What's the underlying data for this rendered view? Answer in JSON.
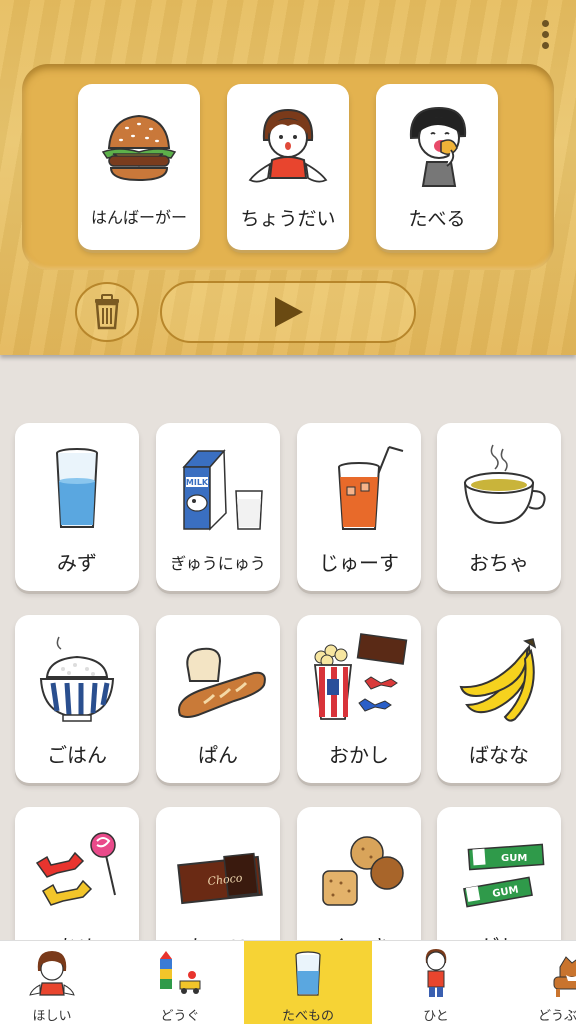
{
  "sentence_cards": [
    {
      "label": "はんばーがー",
      "icon": "hamburger-icon"
    },
    {
      "label": "ちょうだい",
      "icon": "give-me-person-icon"
    },
    {
      "label": "たべる",
      "icon": "eating-person-icon"
    }
  ],
  "controls": {
    "trash_icon": "trash-icon",
    "play_icon": "play-icon",
    "menu_icon": "more-vertical-icon"
  },
  "word_cards": [
    {
      "label": "みず",
      "icon": "water-glass-icon"
    },
    {
      "label": "ぎゅうにゅう",
      "icon": "milk-carton-icon"
    },
    {
      "label": "じゅーす",
      "icon": "juice-glass-icon"
    },
    {
      "label": "おちゃ",
      "icon": "tea-cup-icon"
    },
    {
      "label": "ごはん",
      "icon": "rice-bowl-icon"
    },
    {
      "label": "ぱん",
      "icon": "bread-icon"
    },
    {
      "label": "おかし",
      "icon": "snacks-icon"
    },
    {
      "label": "ばなな",
      "icon": "banana-icon"
    },
    {
      "label": "あめ",
      "icon": "candy-icon"
    },
    {
      "label": "ちょこ",
      "icon": "chocolate-icon"
    },
    {
      "label": "くっき",
      "icon": "cookie-icon"
    },
    {
      "label": "がむ",
      "icon": "gum-icon"
    }
  ],
  "tabs": [
    {
      "label": "ほしい",
      "icon": "want-person-icon",
      "active": false
    },
    {
      "label": "どうぐ",
      "icon": "tools-toys-icon",
      "active": false
    },
    {
      "label": "たべもの",
      "icon": "food-glass-icon",
      "active": true
    },
    {
      "label": "ひと",
      "icon": "people-icon",
      "active": false
    },
    {
      "label": "どうぶつ",
      "icon": "dog-icon",
      "active": false
    }
  ],
  "colors": {
    "wood": "#e9c068",
    "tab_active": "#f6d335",
    "background": "#e6e1dc"
  }
}
